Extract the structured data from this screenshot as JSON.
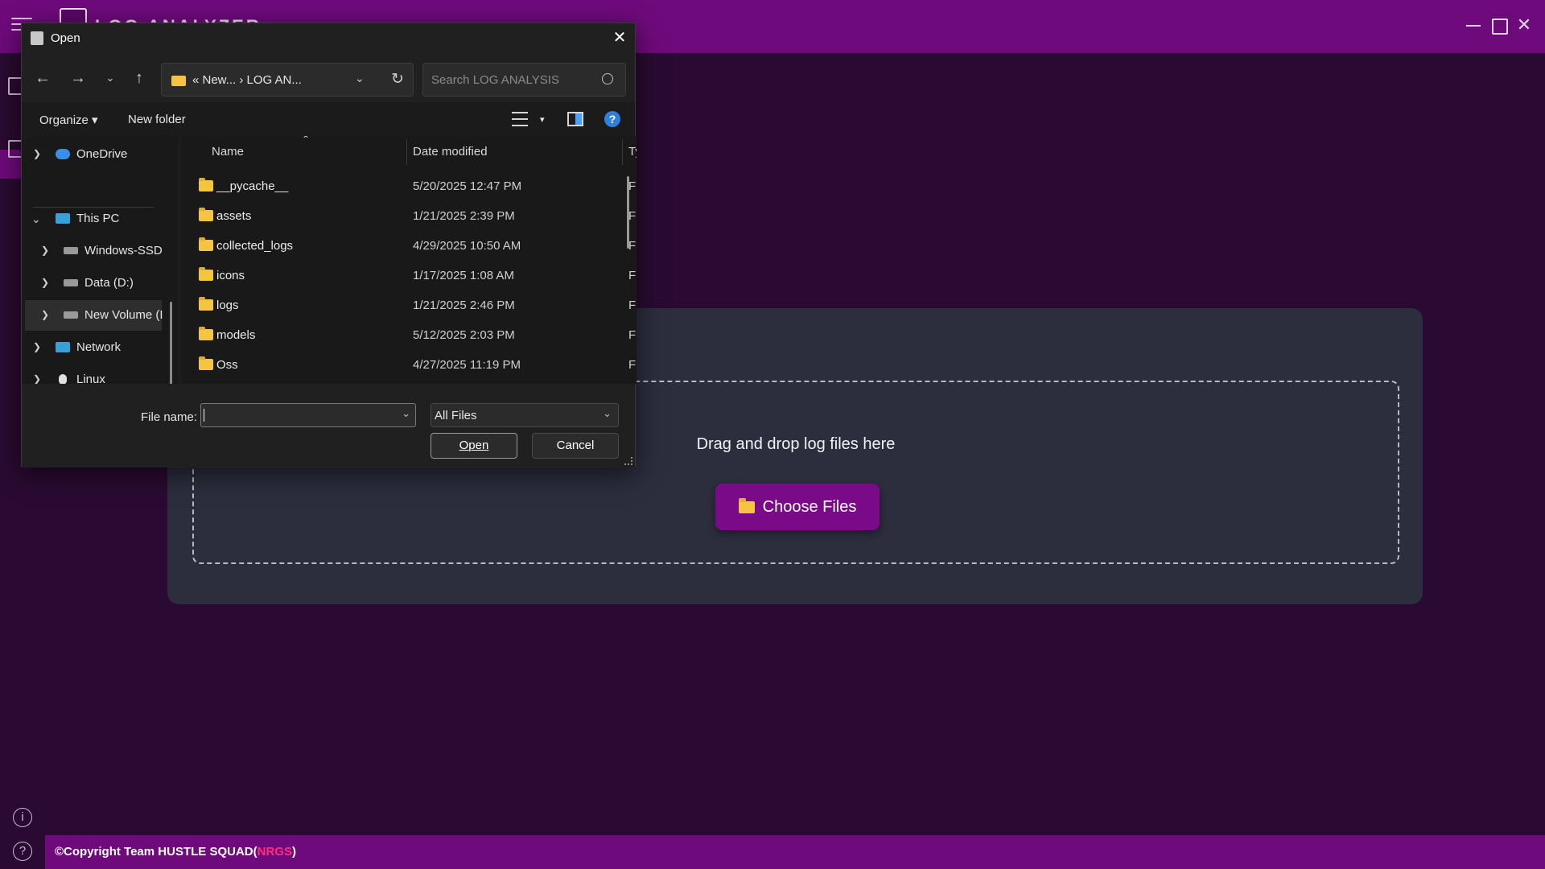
{
  "app": {
    "title": "LOG ANALYZER",
    "footer_prefix": "©Copyright Team HUSTLE SQUAD(",
    "footer_accent": "NRGS",
    "footer_suffix": ")",
    "accent_color": "#6f0a7c"
  },
  "upload": {
    "drop_text": "Drag and drop log files here",
    "choose_label": "Choose Files"
  },
  "dialog": {
    "title": "Open",
    "breadcrumb": "«  New...  ›  LOG AN...",
    "search_placeholder": "Search LOG ANALYSIS",
    "organize_label": "Organize ▾",
    "new_folder_label": "New folder",
    "nav_items": [
      {
        "label": "OneDrive",
        "icon": "onedrive-icon",
        "expanded": false
      },
      {
        "label": "This PC",
        "icon": "pc-icon",
        "expanded": true
      },
      {
        "label": "Windows-SSD",
        "icon": "drive-icon",
        "expanded": false
      },
      {
        "label": "Data (D:)",
        "icon": "drive-icon",
        "expanded": false
      },
      {
        "label": "New Volume (I",
        "icon": "drive-icon",
        "expanded": false,
        "selected": true
      },
      {
        "label": "Network",
        "icon": "network-icon",
        "expanded": false
      },
      {
        "label": "Linux",
        "icon": "linux-icon",
        "expanded": false
      }
    ],
    "columns": {
      "name": "Name",
      "date": "Date modified",
      "type": "Ty"
    },
    "files": [
      {
        "name": "__pycache__",
        "date": "5/20/2025 12:47 PM",
        "type": "Fil"
      },
      {
        "name": "assets",
        "date": "1/21/2025 2:39 PM",
        "type": "Fil"
      },
      {
        "name": "collected_logs",
        "date": "4/29/2025 10:50 AM",
        "type": "Fil"
      },
      {
        "name": "icons",
        "date": "1/17/2025 1:08 AM",
        "type": "Fil"
      },
      {
        "name": "logs",
        "date": "1/21/2025 2:46 PM",
        "type": "Fil"
      },
      {
        "name": "models",
        "date": "5/12/2025 2:03 PM",
        "type": "Fil"
      },
      {
        "name": "Oss",
        "date": "4/27/2025 11:19 PM",
        "type": "Fil"
      }
    ],
    "file_name_label": "File name:",
    "file_name_value": "",
    "file_type": "All Files",
    "open_label": "Open",
    "cancel_label": "Cancel"
  }
}
